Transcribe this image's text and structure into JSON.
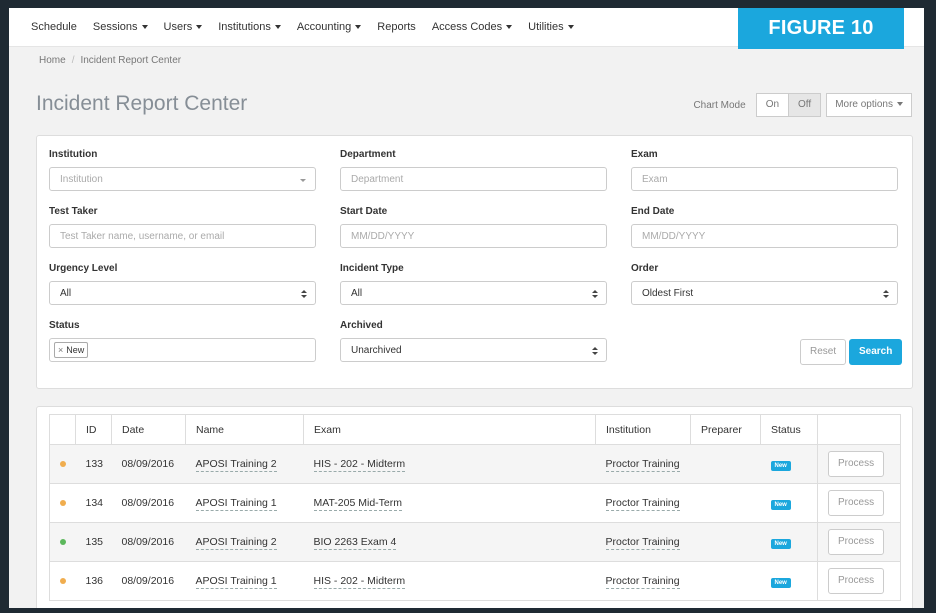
{
  "nav": {
    "items": [
      {
        "label": "Schedule",
        "dropdown": false
      },
      {
        "label": "Sessions",
        "dropdown": true
      },
      {
        "label": "Users",
        "dropdown": true
      },
      {
        "label": "Institutions",
        "dropdown": true
      },
      {
        "label": "Accounting",
        "dropdown": true
      },
      {
        "label": "Reports",
        "dropdown": false
      },
      {
        "label": "Access Codes",
        "dropdown": true
      },
      {
        "label": "Utilities",
        "dropdown": true
      }
    ]
  },
  "figure_label": "FIGURE 10",
  "breadcrumb": {
    "home": "Home",
    "current": "Incident Report Center"
  },
  "page_title": "Incident Report Center",
  "chart_mode": {
    "label": "Chart Mode",
    "on": "On",
    "off": "Off",
    "selected": "Off"
  },
  "more_options": "More options",
  "filters": {
    "institution": {
      "label": "Institution",
      "placeholder": "Institution"
    },
    "department": {
      "label": "Department",
      "placeholder": "Department"
    },
    "exam": {
      "label": "Exam",
      "placeholder": "Exam"
    },
    "test_taker": {
      "label": "Test Taker",
      "placeholder": "Test Taker name, username, or email"
    },
    "start_date": {
      "label": "Start Date",
      "placeholder": "MM/DD/YYYY"
    },
    "end_date": {
      "label": "End Date",
      "placeholder": "MM/DD/YYYY"
    },
    "urgency": {
      "label": "Urgency Level",
      "value": "All"
    },
    "incident_type": {
      "label": "Incident Type",
      "value": "All"
    },
    "order": {
      "label": "Order",
      "value": "Oldest First"
    },
    "status": {
      "label": "Status",
      "tag": "New"
    },
    "archived": {
      "label": "Archived",
      "value": "Unarchived"
    },
    "reset_label": "Reset",
    "search_label": "Search"
  },
  "table": {
    "headers": [
      "ID",
      "Date",
      "Name",
      "Exam",
      "Institution",
      "Preparer",
      "Status"
    ],
    "rows": [
      {
        "id": "133",
        "date": "08/09/2016",
        "name": "APOSI Training 2",
        "exam": "HIS - 202 - Midterm",
        "institution": "Proctor Training",
        "preparer": "",
        "status": "New",
        "action": "Process",
        "urgency_color": "#f0ad4e"
      },
      {
        "id": "134",
        "date": "08/09/2016",
        "name": "APOSI Training 1",
        "exam": "MAT-205 Mid-Term",
        "institution": "Proctor Training",
        "preparer": "",
        "status": "New",
        "action": "Process",
        "urgency_color": "#f0ad4e"
      },
      {
        "id": "135",
        "date": "08/09/2016",
        "name": "APOSI Training 2",
        "exam": "BIO 2263 Exam 4",
        "institution": "Proctor Training",
        "preparer": "",
        "status": "New",
        "action": "Process",
        "urgency_color": "#5cb85c"
      },
      {
        "id": "136",
        "date": "08/09/2016",
        "name": "APOSI Training 1",
        "exam": "HIS - 202 - Midterm",
        "institution": "Proctor Training",
        "preparer": "",
        "status": "New",
        "action": "Process",
        "urgency_color": "#f0ad4e"
      }
    ]
  }
}
